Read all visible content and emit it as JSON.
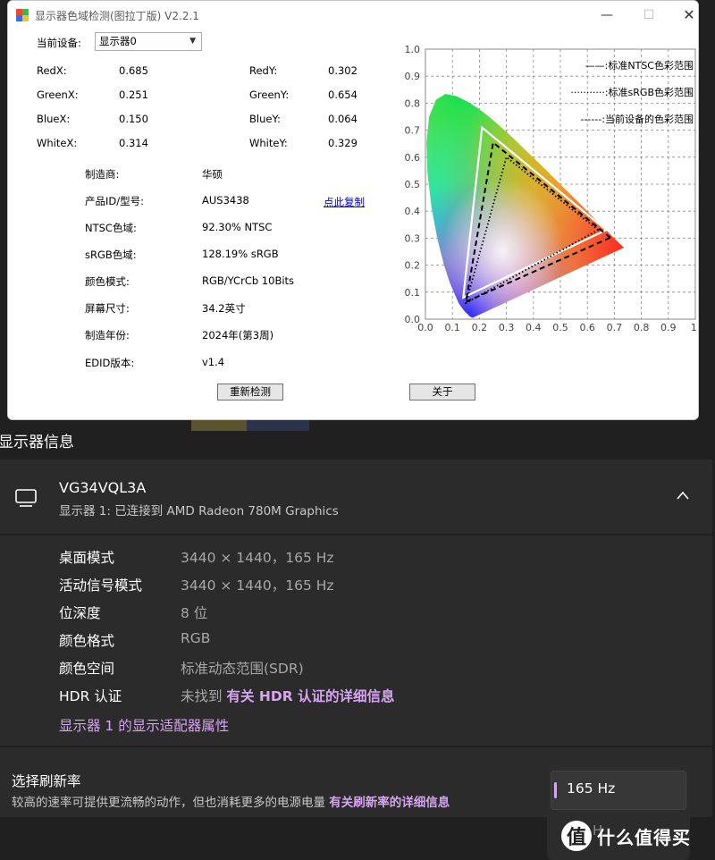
{
  "app": {
    "title": "显示器色域检测(图拉丁版) V2.2.1",
    "device_label": "当前设备:",
    "device_value": "显示器0",
    "coords": [
      {
        "label": "RedX:",
        "value": "0.685"
      },
      {
        "label": "RedY:",
        "value": "0.302"
      },
      {
        "label": "GreenX:",
        "value": "0.251"
      },
      {
        "label": "GreenY:",
        "value": "0.654"
      },
      {
        "label": "BlueX:",
        "value": "0.150"
      },
      {
        "label": "BlueY:",
        "value": "0.064"
      },
      {
        "label": "WhiteX:",
        "value": "0.314"
      },
      {
        "label": "WhiteY:",
        "value": "0.329"
      }
    ],
    "info": [
      {
        "label": "制造商:",
        "value": "华硕"
      },
      {
        "label": "产品ID/型号:",
        "value": "AUS3438"
      },
      {
        "label": "NTSC色域:",
        "value": "92.30% NTSC"
      },
      {
        "label": "sRGB色域:",
        "value": "128.19% sRGB"
      },
      {
        "label": "颜色模式:",
        "value": "RGB/YCrCb 10Bits"
      },
      {
        "label": "屏幕尺寸:",
        "value": "34.2英寸"
      },
      {
        "label": "制造年份:",
        "value": "2024年(第3周)"
      },
      {
        "label": "EDID版本:",
        "value": "v1.4"
      }
    ],
    "copy_link": "点此复制",
    "redetect_button": "重新检测",
    "close_button": "关于"
  },
  "chart_data": {
    "type": "scatter",
    "title": "",
    "xlabel": "",
    "ylabel": "",
    "xlim": [
      0,
      1
    ],
    "ylim": [
      0,
      1
    ],
    "x_ticks": [
      "0.0",
      "0.1",
      "0.2",
      "0.3",
      "0.4",
      "0.5",
      "0.6",
      "0.7",
      "0.8",
      "0.9",
      "1."
    ],
    "y_ticks": [
      "0.0",
      "0.1",
      "0.2",
      "0.3",
      "0.4",
      "0.5",
      "0.6",
      "0.7",
      "0.8",
      "0.9",
      "1.0"
    ],
    "grid": true,
    "legend_position": "top-right",
    "series": [
      {
        "name": "——:标准NTSC色彩范围",
        "style": "solid",
        "color": "#ffffff",
        "points": [
          [
            0.67,
            0.33
          ],
          [
            0.21,
            0.71
          ],
          [
            0.14,
            0.08
          ]
        ]
      },
      {
        "name": "···········:标准sRGB色彩范围",
        "style": "dotted",
        "color": "#000000",
        "points": [
          [
            0.64,
            0.33
          ],
          [
            0.3,
            0.6
          ],
          [
            0.15,
            0.06
          ]
        ]
      },
      {
        "name": "------:当前设备的色彩范围",
        "style": "dashed",
        "color": "#000000",
        "points": [
          [
            0.685,
            0.302
          ],
          [
            0.251,
            0.654
          ],
          [
            0.15,
            0.064
          ]
        ]
      }
    ]
  },
  "settings": {
    "section_title": "显示器信息",
    "monitor_name": "VG34VQL3A",
    "monitor_sub": "显示器 1: 已连接到 AMD Radeon 780M Graphics",
    "props": [
      {
        "label": "桌面模式",
        "value": "3440 × 1440，165 Hz"
      },
      {
        "label": "活动信号模式",
        "value": "3440 × 1440，165 Hz"
      },
      {
        "label": "位深度",
        "value": "8 位"
      },
      {
        "label": "颜色格式",
        "value": "RGB"
      },
      {
        "label": "颜色空间",
        "value": "标准动态范围(SDR)"
      },
      {
        "label": "HDR 认证",
        "value": "未找到"
      }
    ],
    "hdr_link": "有关 HDR 认证的详细信息",
    "adapter_link": "显示器 1 的显示适配器属性",
    "refresh_title": "选择刷新率",
    "refresh_desc": "较高的速率可提供更流畅的动作，但也消耗更多的电源电量",
    "refresh_link": "有关刷新率的详细信息",
    "refresh_value": "165 Hz",
    "refresh_next": "H",
    "accent_color": "#d7a4f2"
  },
  "watermark": {
    "badge": "值",
    "text": "什么值得买"
  }
}
